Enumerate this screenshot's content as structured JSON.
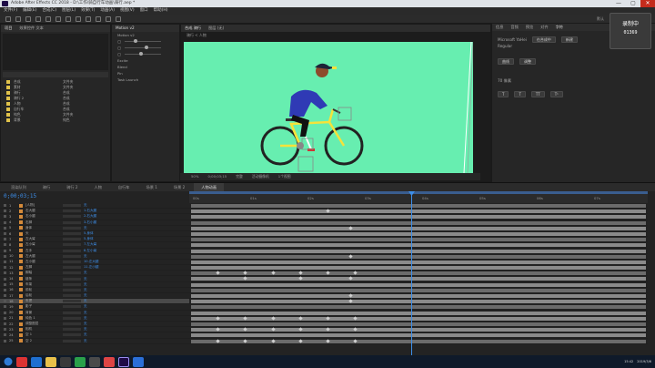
{
  "window": {
    "title": "Adobe After Effects CC 2018 - D:\\工作\\骑自行车动画\\骑行.aep *",
    "controls": [
      "—",
      "▢",
      "✕"
    ]
  },
  "menu": [
    "文件(F)",
    "编辑(E)",
    "合成(C)",
    "图层(L)",
    "效果(T)",
    "动画(A)",
    "视图(V)",
    "窗口",
    "帮助(H)"
  ],
  "workspaces": [
    "默认",
    "标准",
    "小屏幕",
    "库"
  ],
  "project": {
    "tabs": [
      "项目",
      "效果控件 文本"
    ],
    "items": [
      {
        "name": "合成",
        "type": "文件夹"
      },
      {
        "name": "素材",
        "type": "文件夹"
      },
      {
        "name": "骑行",
        "type": "合成"
      },
      {
        "name": "骑行 2",
        "type": "合成"
      },
      {
        "name": "人物",
        "type": "合成"
      },
      {
        "name": "自行车",
        "type": "合成"
      },
      {
        "name": "纯色",
        "type": "文件夹"
      },
      {
        "name": "背景",
        "type": "纯色"
      }
    ]
  },
  "effects_panel": {
    "title": "Motion v2",
    "rows": [
      "Motion v2",
      "Excite",
      "Blend",
      "Pin",
      "Task Launch"
    ]
  },
  "composition": {
    "tabs": [
      "合成 骑行",
      "图层 (无)"
    ],
    "breadcrumb": "骑行 < 人物",
    "bg_color": "#67eeb0",
    "zoom": "50%",
    "timecode": "0;00;03;15",
    "view": "完整",
    "camera": "活动摄像机",
    "views": "1个视图"
  },
  "right_panel": {
    "tabs": [
      "信息",
      "音频",
      "预览",
      "对齐",
      "字符",
      "段落"
    ],
    "font": "Microsoft YaHei",
    "font_style": "Regular",
    "buttons": [
      "在合成中",
      "新建",
      "曲线",
      "调整"
    ],
    "size_label": "70 像素",
    "overlay_text": [
      "录制中",
      "01369"
    ]
  },
  "timeline": {
    "tabs": [
      "渲染队列",
      "骑行",
      "骑行 2",
      "人物",
      "自行车",
      "场景 1",
      "场景 2",
      "人物动画"
    ],
    "active_tab": "人物动画",
    "timecode": "0;00;03;15",
    "ruler_ticks": [
      "00s",
      "01s",
      "02s",
      "03s",
      "04s",
      "05s",
      "06s",
      "07s"
    ],
    "layers": [
      {
        "name": "[人物]",
        "parent": "无",
        "keys": []
      },
      {
        "name": "右大腿",
        "parent": "1.右大腿",
        "keys": [
          0.3
        ]
      },
      {
        "name": "右小腿",
        "parent": "2.右大腿",
        "keys": []
      },
      {
        "name": "右脚",
        "parent": "3.右小腿",
        "keys": []
      },
      {
        "name": "身体",
        "parent": "无",
        "keys": [
          0.35
        ]
      },
      {
        "name": "头",
        "parent": "5.身体",
        "keys": []
      },
      {
        "name": "左大臂",
        "parent": "5.身体",
        "keys": []
      },
      {
        "name": "左小臂",
        "parent": "7.左大臂",
        "keys": []
      },
      {
        "name": "左手",
        "parent": "8.左小臂",
        "keys": []
      },
      {
        "name": "左大腿",
        "parent": "无",
        "keys": [
          0.35
        ]
      },
      {
        "name": "左小腿",
        "parent": "10.左大腿",
        "keys": []
      },
      {
        "name": "左脚",
        "parent": "11.左小腿",
        "keys": []
      },
      {
        "name": "脚踏",
        "parent": "无",
        "keys": [
          0.06,
          0.12,
          0.18,
          0.24,
          0.3,
          0.36
        ]
      },
      {
        "name": "链条",
        "parent": "无",
        "keys": [
          0.12,
          0.24,
          0.35
        ]
      },
      {
        "name": "车架",
        "parent": "无",
        "keys": []
      },
      {
        "name": "前轮",
        "parent": "无",
        "keys": []
      },
      {
        "name": "后轮",
        "parent": "无",
        "keys": [
          0.35
        ]
      },
      {
        "name": "车把",
        "parent": "无",
        "keys": [
          0.35
        ]
      },
      {
        "name": "影子",
        "parent": "无",
        "keys": []
      },
      {
        "name": "背景",
        "parent": "无",
        "keys": []
      },
      {
        "name": "纯色 1",
        "parent": "无",
        "keys": [
          0.06,
          0.12,
          0.18,
          0.24,
          0.3,
          0.36
        ]
      },
      {
        "name": "调整图层",
        "parent": "无",
        "keys": []
      },
      {
        "name": "相机",
        "parent": "无",
        "keys": [
          0.06,
          0.12,
          0.18,
          0.24,
          0.3,
          0.36
        ]
      },
      {
        "name": "空 1",
        "parent": "无",
        "keys": []
      },
      {
        "name": "空 2",
        "parent": "无",
        "keys": [
          0.06,
          0.12,
          0.18,
          0.24,
          0.3,
          0.36
        ]
      }
    ]
  },
  "taskbar": {
    "clock": "15:42",
    "date": "2019/3/6"
  }
}
